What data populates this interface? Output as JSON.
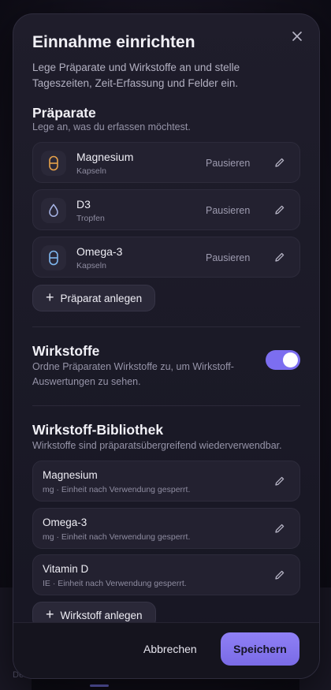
{
  "background": {
    "hint_text": "Det"
  },
  "modal": {
    "title": "Einnahme einrichten",
    "subtitle": "Lege Präparate und Wirkstoffe an und stelle Tageszeiten, Zeit-Erfassung und Felder ein."
  },
  "preparations": {
    "title": "Präparate",
    "subtitle": "Lege an, was du erfassen möchtest.",
    "items": [
      {
        "name": "Magnesium",
        "form": "Kapseln",
        "icon": "capsule-icon",
        "action": "Pausieren",
        "color": "#e7a24a"
      },
      {
        "name": "D3",
        "form": "Tropfen",
        "icon": "drop-icon",
        "action": "Pausieren",
        "color": "#a9b6e8"
      },
      {
        "name": "Omega-3",
        "form": "Kapseln",
        "icon": "capsule-icon",
        "action": "Pausieren",
        "color": "#7fb8f0"
      }
    ],
    "add_label": "Präparat anlegen"
  },
  "ingredients": {
    "title": "Wirkstoffe",
    "subtitle": "Ordne Präparaten Wirkstoffe zu, um Wirkstoff-Auswertungen zu sehen.",
    "enabled": true
  },
  "library": {
    "title": "Wirkstoff-Bibliothek",
    "subtitle": "Wirkstoffe sind präparatsübergreifend wiederverwendbar.",
    "items": [
      {
        "name": "Magnesium",
        "note": "mg · Einheit nach Verwendung gesperrt."
      },
      {
        "name": "Omega-3",
        "note": "mg · Einheit nach Verwendung gesperrt."
      },
      {
        "name": "Vitamin D",
        "note": "IE · Einheit nach Verwendung gesperrt."
      }
    ],
    "add_label": "Wirkstoff anlegen"
  },
  "footer": {
    "cancel_label": "Abbrechen",
    "save_label": "Speichern"
  },
  "colors": {
    "accent": "#7c6ef0",
    "save": "#8f80f5"
  }
}
